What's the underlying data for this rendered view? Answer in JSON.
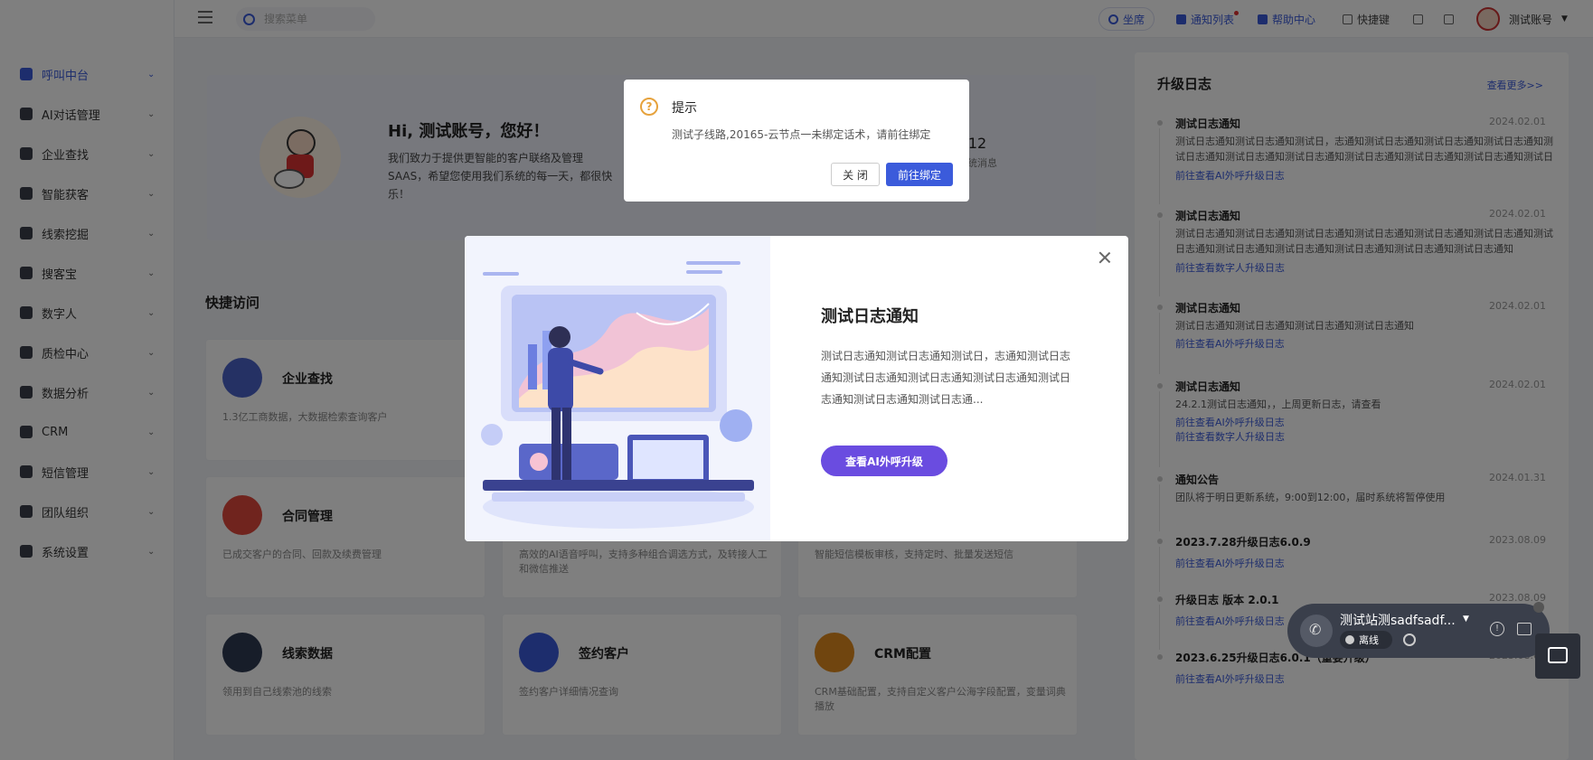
{
  "sidebar": {
    "items": [
      {
        "label": "呼叫中台"
      },
      {
        "label": "AI对话管理"
      },
      {
        "label": "企业查找"
      },
      {
        "label": "智能获客"
      },
      {
        "label": "线索挖掘"
      },
      {
        "label": "搜客宝"
      },
      {
        "label": "数字人"
      },
      {
        "label": "质检中心"
      },
      {
        "label": "数据分析"
      },
      {
        "label": "CRM"
      },
      {
        "label": "短信管理"
      },
      {
        "label": "团队组织"
      },
      {
        "label": "系统设置"
      }
    ]
  },
  "topbar": {
    "search_placeholder": "搜索菜单",
    "seat": "坐席",
    "notify": "通知列表",
    "help": "帮助中心",
    "shortcut": "快捷键",
    "user": "测试账号"
  },
  "welcome": {
    "greeting": "Hi, 测试账号，您好！",
    "text": "我们致力于提供更智能的客户联络及管理SAAS，希望您使用我们系统的每一天，都很快乐！",
    "stat_num": "12",
    "stat_label": "系统消息"
  },
  "quick": {
    "title": "快捷访问",
    "cards": [
      {
        "title": "企业查找",
        "desc": "1.3亿工商数据，大数据检索查询客户"
      },
      {
        "title": "合同管理",
        "desc": "已成交客户的合同、回款及续费管理"
      },
      {
        "title": "",
        "desc": "高效的AI语音呼叫，支持多种组合调选方式，及转接人工和微信推送"
      },
      {
        "title": "",
        "desc": "智能短信模板审核，支持定时、批量发送短信"
      },
      {
        "title": "线索数据",
        "desc": "领用到自己线索池的线索"
      },
      {
        "title": "签约客户",
        "desc": "签约客户详细情况查询"
      },
      {
        "title": "CRM配置",
        "desc": "CRM基础配置，支持自定义客户公海字段配置，变量词典播放"
      }
    ]
  },
  "logs": {
    "title": "升级日志",
    "more": "查看更多>>",
    "items": [
      {
        "title": "测试日志通知",
        "date": "2024.02.01",
        "content": "测试日志通知测试日志通知测试日，志通知测试日志通知测试日志通知测试日志通知测试日志通知测试日志通知测试日志通知测试日志通知测试日志通知测试日志通知测试日志通...",
        "links": [
          "前往查看AI外呼升级日志"
        ]
      },
      {
        "title": "测试日志通知",
        "date": "2024.02.01",
        "content": "测试日志通知测试日志通知测试日志通知测试日志通知测试日志通知测试日志通知测试日志通知测试日志通知测试日志通知测试日志通知测试日志通知测试日志通知",
        "links": [
          "前往查看数字人升级日志"
        ]
      },
      {
        "title": "测试日志通知",
        "date": "2024.02.01",
        "content": "测试日志通知测试日志通知测试日志通知测试日志通知",
        "links": [
          "前往查看AI外呼升级日志"
        ]
      },
      {
        "title": "测试日志通知",
        "date": "2024.02.01",
        "content": "24.2.1测试日志通知，，上周更新日志，请查看",
        "links": [
          "前往查看AI外呼升级日志",
          "前往查看数字人升级日志"
        ]
      },
      {
        "title": "通知公告",
        "date": "2024.01.31",
        "content": "团队将于明日更新系统，9:00到12:00，届时系统将暂停使用",
        "links": []
      },
      {
        "title": "2023.7.28升级日志6.0.9",
        "date": "2023.08.09",
        "content": "",
        "links": [
          "前往查看AI外呼升级日志"
        ]
      },
      {
        "title": "升级日志 版本 2.0.1",
        "date": "2023.08.09",
        "content": "",
        "links": [
          "前往查看AI外呼升级日志"
        ]
      },
      {
        "title": "2023.6.25升级日志6.0.1（重要升级）",
        "date": "2023.08.09",
        "content": "",
        "links": [
          "前往查看AI外呼升级日志"
        ]
      }
    ]
  },
  "alert": {
    "title": "提示",
    "message": "测试子线路,20165-云节点一未绑定话术，请前往绑定",
    "close": "关 闭",
    "confirm": "前往绑定"
  },
  "modal": {
    "title": "测试日志通知",
    "body": "测试日志通知测试日志通知测试日，志通知测试日志通知测试日志通知测试日志通知测试日志通知测试日志通知测试日志通知测试日志通...",
    "button": "查看AI外呼升级"
  },
  "call_widget": {
    "name": "测试站测sadfsadf...",
    "status": "离线"
  }
}
